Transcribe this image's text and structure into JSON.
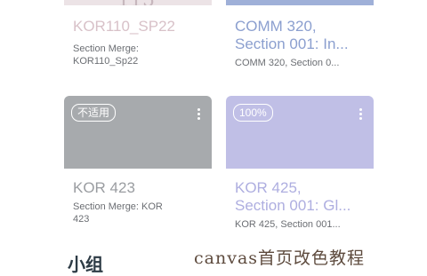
{
  "cards": [
    {
      "title": "KOR110_SP22",
      "subtitle_line1": "Section Merge:",
      "subtitle_line2": "KOR110_Sp22",
      "band_color": "#ece3e6",
      "title_color": "#d8c1c8"
    },
    {
      "title_line1": "COMM 320,",
      "title_line2": "Section 001: In...",
      "subtitle": "COMM 320, Section 0...",
      "band_color": "#9fb0d8",
      "title_color": "#8b9fcf"
    },
    {
      "title": "KOR 423",
      "subtitle_line1": "Section Merge: KOR",
      "subtitle_line2": "423",
      "badge": "不适用",
      "band_color": "#a7aaad",
      "title_color": "#9a9da1"
    },
    {
      "title_line1": "KOR 425,",
      "title_line2": "Section 001: Gl...",
      "subtitle": "KOR 425, Section 001...",
      "badge": "100%",
      "band_color": "#c0bfe6",
      "title_color": "#aeaee0"
    }
  ],
  "section_label": "小组",
  "watermark": "canvas首页改色教程",
  "icons": {
    "menu": "kebab-menu-icon"
  }
}
